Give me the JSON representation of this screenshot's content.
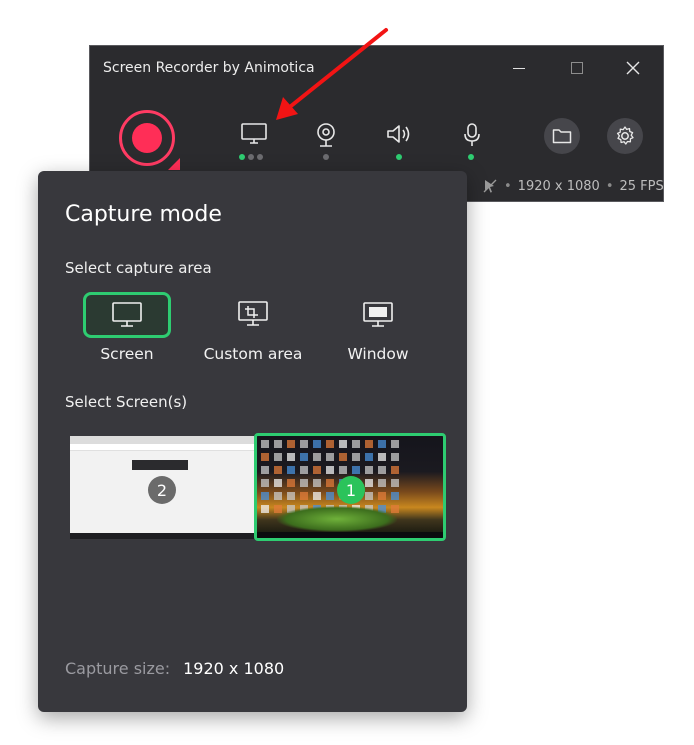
{
  "recorder": {
    "title": "Screen Recorder by Animotica",
    "resolution": "1920 x 1080",
    "fps": "25 FPS",
    "separator": "•",
    "accent": "#ff2e57",
    "indicator_on": "#2ecc71",
    "tools": [
      {
        "name": "screen",
        "icon": "monitor-icon",
        "dots": [
          "on",
          "off",
          "off"
        ]
      },
      {
        "name": "webcam",
        "icon": "webcam-icon",
        "dots": [
          "off"
        ]
      },
      {
        "name": "system-audio",
        "icon": "speaker-icon",
        "dots": [
          "on"
        ]
      },
      {
        "name": "microphone",
        "icon": "microphone-icon",
        "dots": [
          "on"
        ]
      }
    ]
  },
  "capture": {
    "title": "Capture mode",
    "area_label": "Select capture area",
    "modes": [
      {
        "label": "Screen",
        "icon": "monitor-icon",
        "selected": true
      },
      {
        "label": "Custom area",
        "icon": "crop-monitor-icon",
        "selected": false
      },
      {
        "label": "Window",
        "icon": "window-icon",
        "selected": false
      }
    ],
    "screens_label": "Select Screen(s)",
    "screens": [
      {
        "number": "2",
        "selected": false
      },
      {
        "number": "1",
        "selected": true
      }
    ],
    "size_label": "Capture size:",
    "size_value": "1920 x 1080",
    "selected_color": "#2ecc71"
  }
}
